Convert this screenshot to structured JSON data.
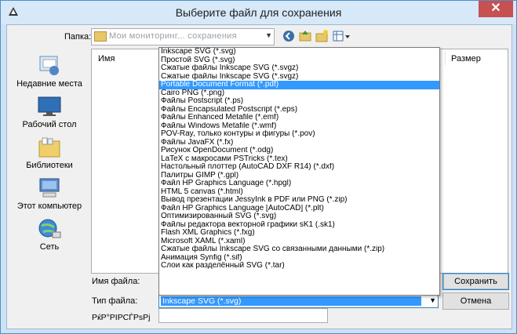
{
  "window": {
    "title": "Выберите файл для сохранения",
    "close_glyph": "✕"
  },
  "folder": {
    "label": "Папка:",
    "value": "Мои мониторинг... сохранения"
  },
  "places": [
    {
      "label": "Недавние места",
      "icon": "recent-places-icon"
    },
    {
      "label": "Рабочий стол",
      "icon": "desktop-icon"
    },
    {
      "label": "Библиотеки",
      "icon": "libraries-icon"
    },
    {
      "label": "Этот компьютер",
      "icon": "computer-icon"
    },
    {
      "label": "Сеть",
      "icon": "network-icon"
    }
  ],
  "list": {
    "col_name": "Имя",
    "col_size": "Размер"
  },
  "form": {
    "filename_label": "Имя файла:",
    "filetype_label": "Тип файла:",
    "filetype_value": "Inkscape SVG (*.svg)",
    "extra_label": "РќР°РІРСЃРѕРј",
    "save_button": "Сохранить",
    "cancel_button": "Отмена"
  },
  "filetypes": [
    "Inkscape SVG (*.svg)",
    "Простой SVG (*.svg)",
    "Сжатые файлы Inkscape SVG (*.svgz)",
    "Сжатые файлы Inkscape SVG (*.svgz)",
    "Portable Document Format (*.pdf)",
    "Cairo PNG (*.png)",
    "Файлы Postscript (*.ps)",
    "Файлы Encapsulated Postscript (*.eps)",
    "Файлы Enhanced Metafile (*.emf)",
    "Файлы Windows Metafile (*.wmf)",
    "POV-Ray, только контуры и фигуры (*.pov)",
    "Файлы JavaFX (*.fx)",
    "Рисунок OpenDocument (*.odg)",
    "LaTeX с макросами PSTricks (*.tex)",
    "Настольный плоттер (AutoCAD DXF R14) (*.dxf)",
    "Палитры GIMP (*.gpl)",
    "Файл HP Graphics Language (*.hpgl)",
    "HTML 5 canvas (*.html)",
    "Вывод презентации JessyInk в PDF или PNG (*.zip)",
    "Файл HP Graphics Language [AutoCAD] (*.plt)",
    "Оптимизированный SVG (*.svg)",
    "Файлы редактора векторной графики sK1 (.sk1)",
    "Flash XML Graphics (*.fxg)",
    "Microsoft XAML (*.xaml)",
    "Сжатые файлы Inkscape SVG со связанными данными (*.zip)",
    "Анимация Synfig (*.sif)",
    "Слои как разделённый SVG (*.tar)"
  ],
  "selected_filetype_index": 4
}
